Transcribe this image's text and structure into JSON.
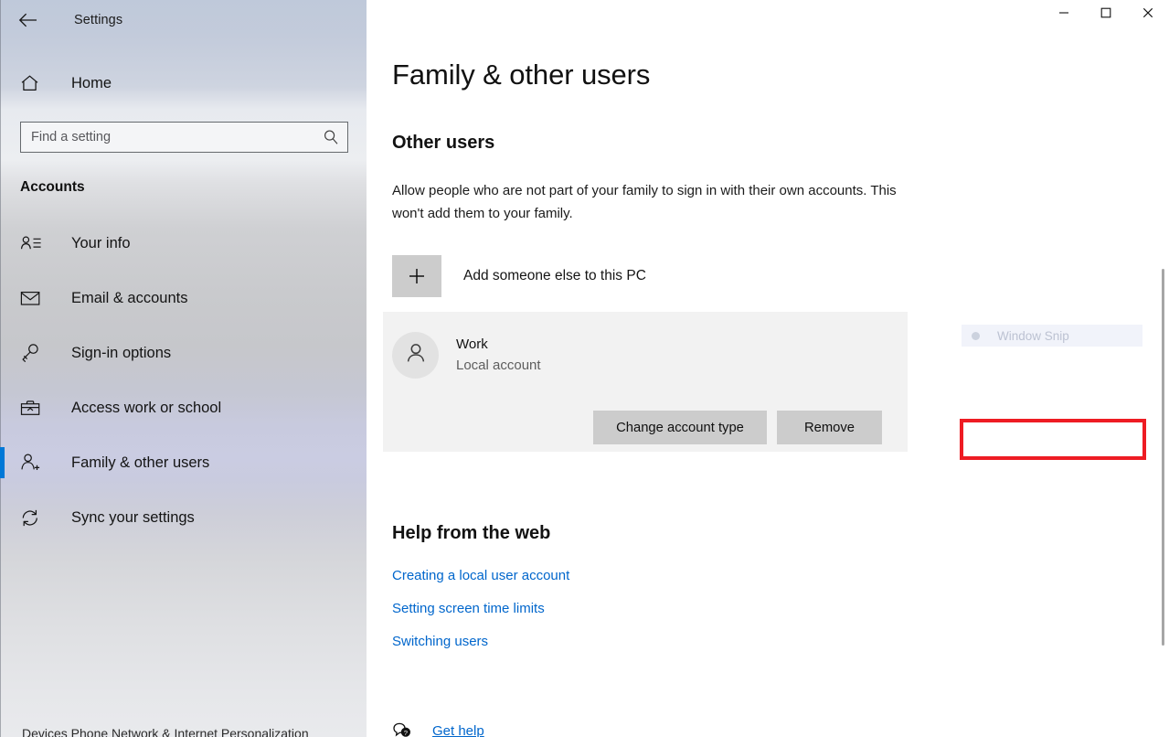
{
  "window": {
    "title": "Settings",
    "back_icon": "back-arrow-icon",
    "controls": {
      "minimize": "minimize-icon",
      "maximize": "maximize-icon",
      "close": "close-icon"
    }
  },
  "sidebar": {
    "home": {
      "label": "Home",
      "icon": "home-icon"
    },
    "search": {
      "placeholder": "Find a setting",
      "value": "",
      "icon": "search-icon"
    },
    "category": "Accounts",
    "items": [
      {
        "label": "Your info",
        "icon": "contact-card-icon",
        "selected": false
      },
      {
        "label": "Email & accounts",
        "icon": "mail-icon",
        "selected": false
      },
      {
        "label": "Sign-in options",
        "icon": "key-icon",
        "selected": false
      },
      {
        "label": "Access work or school",
        "icon": "briefcase-icon",
        "selected": false
      },
      {
        "label": "Family & other users",
        "icon": "add-user-icon",
        "selected": true
      },
      {
        "label": "Sync your settings",
        "icon": "sync-icon",
        "selected": false
      }
    ],
    "clipped_bottom_text": "Devices  Phone  Network & Internet  Personalization"
  },
  "main": {
    "page_title": "Family & other users",
    "section_heading": "Other users",
    "section_description": "Allow people who are not part of your family to sign in with their own accounts. This won't add them to your family.",
    "add_user": {
      "label": "Add someone else to this PC",
      "icon": "plus-icon"
    },
    "account": {
      "name": "Work",
      "type": "Local account",
      "avatar_icon": "person-icon",
      "change_type_button": "Change account type",
      "remove_button": "Remove"
    },
    "ghost_overlay": {
      "label": "Window Snip",
      "icon": "window-snip-icon"
    },
    "help": {
      "heading": "Help from the web",
      "links": [
        "Creating a local user account",
        "Setting screen time limits",
        "Switching users"
      ]
    },
    "get_help": {
      "label": "Get help",
      "icon": "question-bubble-icon"
    }
  },
  "colors": {
    "accent": "#0078d7",
    "highlight_box": "#ee1c23",
    "link": "#0066cc",
    "button_face": "#cccccc",
    "card_background": "#f2f2f2"
  }
}
